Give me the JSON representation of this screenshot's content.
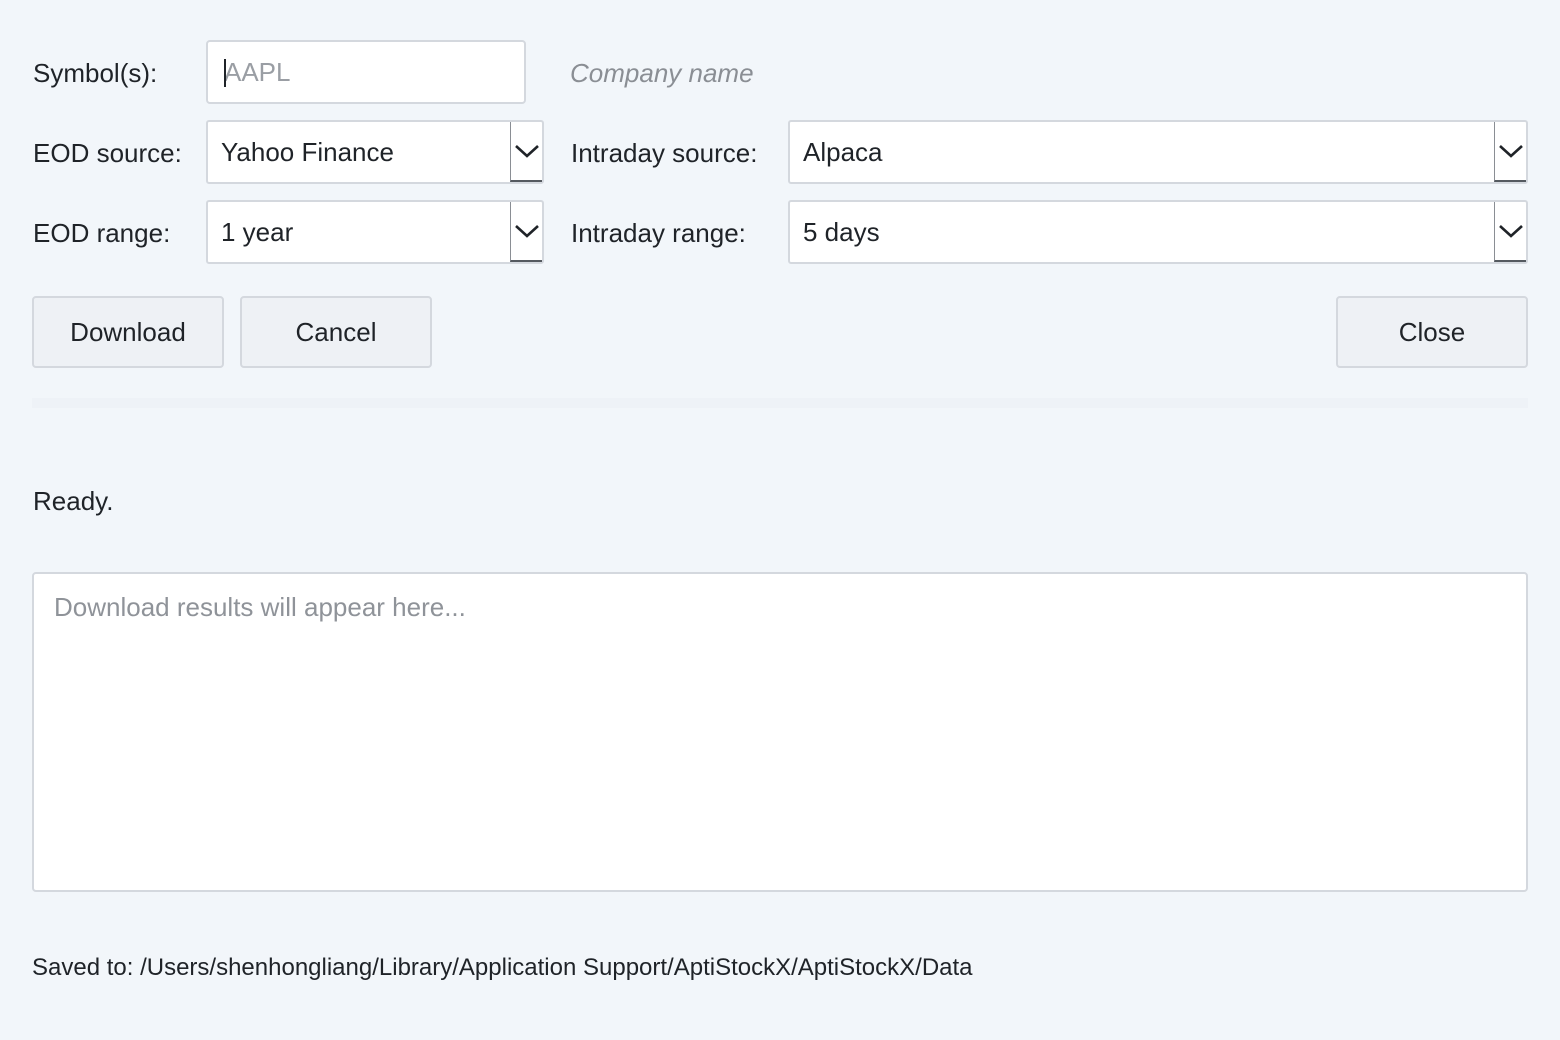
{
  "form": {
    "symbol_label": "Symbol(s):",
    "symbol_placeholder": "AAPL",
    "symbol_value": "",
    "company_name_hint": "Company name",
    "eod_source_label": "EOD source:",
    "eod_source_value": "Yahoo Finance",
    "intraday_source_label": "Intraday source:",
    "intraday_source_value": "Alpaca",
    "eod_range_label": "EOD range:",
    "eod_range_value": "1 year",
    "intraday_range_label": "Intraday range:",
    "intraday_range_value": "5 days"
  },
  "buttons": {
    "download": "Download",
    "cancel": "Cancel",
    "close": "Close"
  },
  "status": {
    "text": "Ready."
  },
  "results": {
    "placeholder": "Download results will appear here...",
    "value": ""
  },
  "footer": {
    "saved_to": "Saved to: /Users/shenhongliang/Library/Application Support/AptiStockX/AptiStockX/Data"
  },
  "icons": {
    "dropdown": "chevron-down-icon"
  }
}
